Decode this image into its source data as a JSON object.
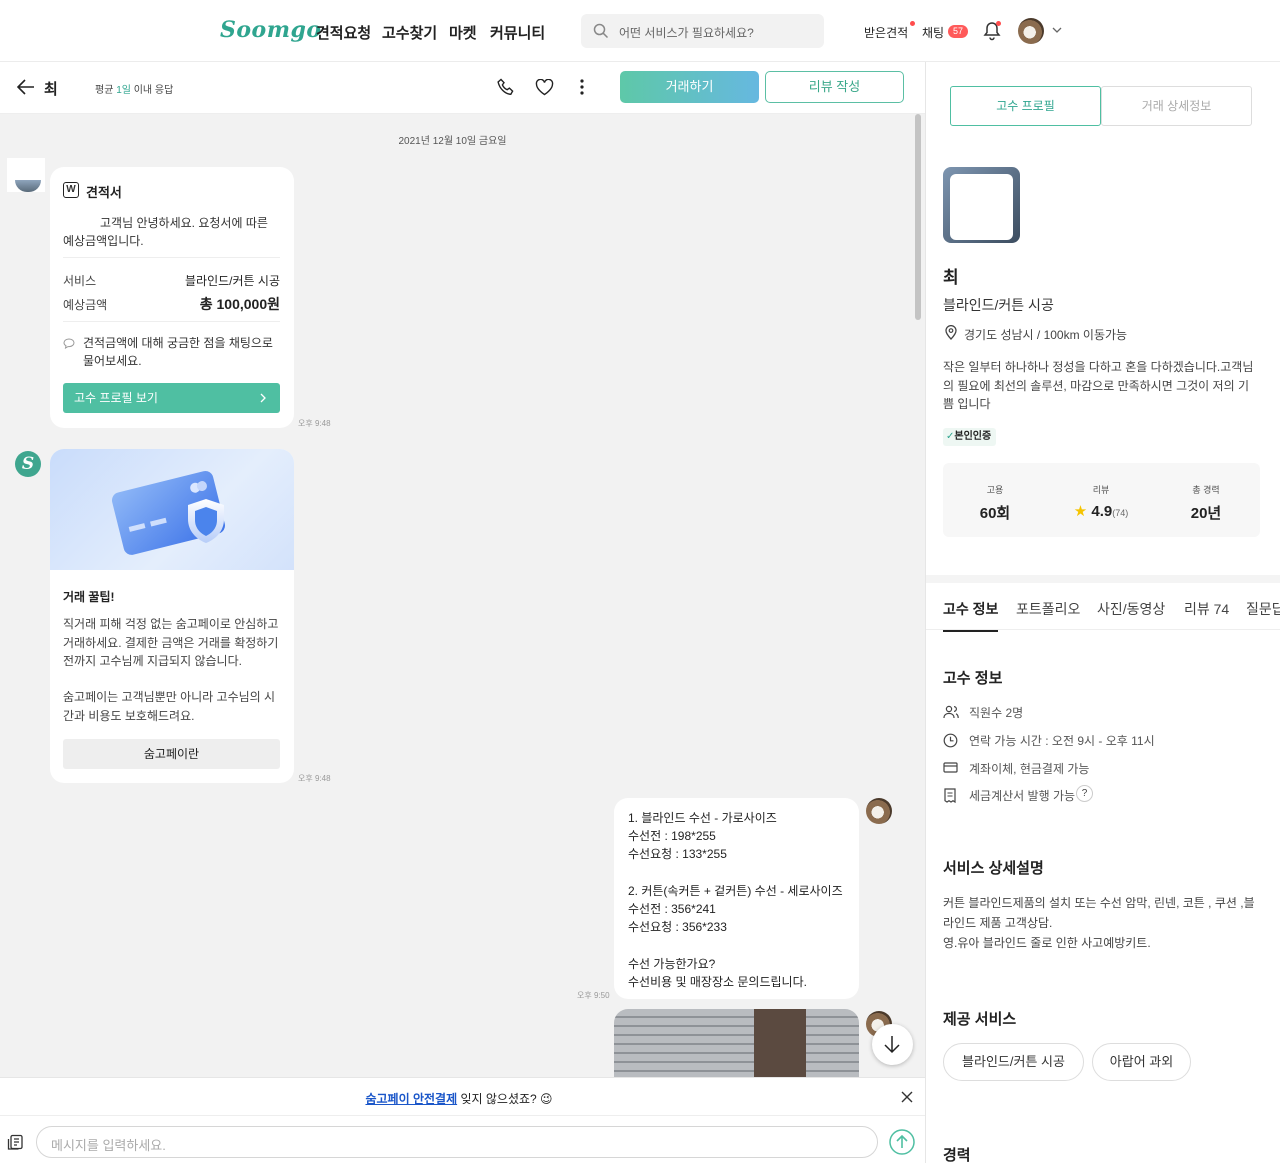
{
  "header": {
    "logo": "Soomgo",
    "nav": [
      "견적요청",
      "고수찾기",
      "마켓",
      "커뮤니티"
    ],
    "search_placeholder": "어떤 서비스가 필요하세요?",
    "received_quotes": "받은견적",
    "chat": "채팅",
    "chat_count": "57"
  },
  "chat_header": {
    "back": "←",
    "name": "최",
    "response_prefix": "평균 ",
    "response_highlight": "1일",
    "response_suffix": " 이내 응답",
    "deal_button": "거래하기",
    "review_button": "리뷰 작성"
  },
  "chat": {
    "date": "2021년 12월 10일 금요일",
    "quote": {
      "icon_letter": "W",
      "title": "견적서",
      "intro": "고객님 안녕하세요. 요청서에 따른 예상금액입니다.",
      "service_label": "서비스",
      "service_value": "블라인드/커튼 시공",
      "price_label": "예상금액",
      "price_value": "총 100,000원",
      "note": "견적금액에 대해 궁금한 점을 채팅으로 물어보세요.",
      "profile_button": "고수 프로필 보기",
      "time": "오후 9:48"
    },
    "tip": {
      "title": "거래 꿀팁!",
      "para1": "직거래 피해 걱정 없는 숨고페이로 안심하고 거래하세요. 결제한 금액은 거래를 확정하기 전까지 고수님께 지급되지 않습니다.",
      "para2": "숨고페이는 고객님뿐만 아니라 고수님의 시간과 비용도 보호해드려요.",
      "button": "숨고페이란",
      "time": "오후 9:48"
    },
    "my_message": {
      "text": "1. 블라인드 수선 - 가로사이즈\n수선전 : 198*255\n수선요청 : 133*255\n\n2. 커튼(속커튼 + 겉커튼) 수선 - 세로사이즈\n수선전 : 356*241\n수선요청 : 356*233\n\n수선 가능한가요?\n수선비용 및 매장장소 문의드립니다.",
      "time": "오후 9:50"
    }
  },
  "bottom": {
    "banner_link": "숨고페이 안전결제",
    "banner_text": " 잊지 않으셨죠? 😉",
    "input_placeholder": "메시지를 입력하세요."
  },
  "profile": {
    "tab_profile": "고수 프로필",
    "tab_detail": "거래 상세정보",
    "name": "최",
    "category": "블라인드/커튼 시공",
    "location": "경기도 성남시 / 100km 이동가능",
    "intro": "작은 일부터 하나하나 정성을 다하고 혼을 다하겠습니다.고객님의 필요에 최선의 솔루션, 마감으로 만족하시면 그것이 저의 기쁨 입니다",
    "verified": "본인인증",
    "hire_label": "고용",
    "hire_value": "60회",
    "review_label": "리뷰",
    "rating": "4.9",
    "review_count": "(74)",
    "career_label": "총 경력",
    "career_value": "20년",
    "tabs": [
      "고수 정보",
      "포트폴리오",
      "사진/동영상",
      "리뷰 74",
      "질문답"
    ],
    "info_title": "고수 정보",
    "employees": "직원수 2명",
    "contact_hours": "연락 가능 시간 : 오전 9시 - 오후 11시",
    "payment": "계좌이체, 현금결제 가능",
    "tax_invoice": "세금계산서 발행 가능",
    "service_title": "서비스 상세설명",
    "service_desc": "커튼 블라인드제품의 설치 또는 수선 암막, 린넨, 코튼 , 쿠션 ,블라인드 제품 고객상담.\n영.유아 블라인드 줄로 인한 사고예방키트.",
    "provided_title": "제공 서비스",
    "provided": [
      "블라인드/커튼 시공",
      "아랍어 과외"
    ],
    "career_title": "경력"
  },
  "colors": {
    "accent": "#2fa58f",
    "badge": "#ff5a5a",
    "link": "#1a73e8"
  }
}
